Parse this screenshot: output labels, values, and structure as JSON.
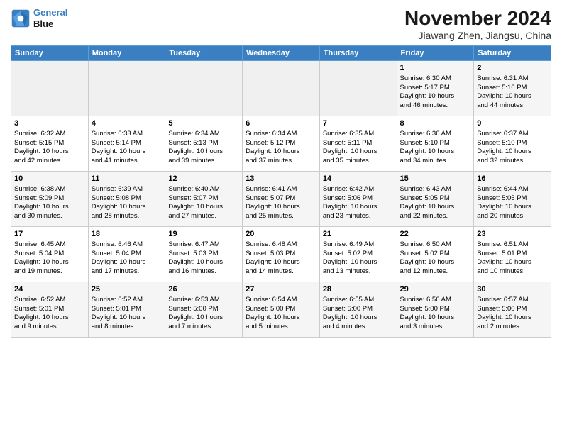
{
  "logo": {
    "line1": "General",
    "line2": "Blue"
  },
  "header": {
    "month": "November 2024",
    "location": "Jiawang Zhen, Jiangsu, China"
  },
  "weekdays": [
    "Sunday",
    "Monday",
    "Tuesday",
    "Wednesday",
    "Thursday",
    "Friday",
    "Saturday"
  ],
  "weeks": [
    [
      {
        "day": "",
        "info": ""
      },
      {
        "day": "",
        "info": ""
      },
      {
        "day": "",
        "info": ""
      },
      {
        "day": "",
        "info": ""
      },
      {
        "day": "",
        "info": ""
      },
      {
        "day": "1",
        "info": "Sunrise: 6:30 AM\nSunset: 5:17 PM\nDaylight: 10 hours\nand 46 minutes."
      },
      {
        "day": "2",
        "info": "Sunrise: 6:31 AM\nSunset: 5:16 PM\nDaylight: 10 hours\nand 44 minutes."
      }
    ],
    [
      {
        "day": "3",
        "info": "Sunrise: 6:32 AM\nSunset: 5:15 PM\nDaylight: 10 hours\nand 42 minutes."
      },
      {
        "day": "4",
        "info": "Sunrise: 6:33 AM\nSunset: 5:14 PM\nDaylight: 10 hours\nand 41 minutes."
      },
      {
        "day": "5",
        "info": "Sunrise: 6:34 AM\nSunset: 5:13 PM\nDaylight: 10 hours\nand 39 minutes."
      },
      {
        "day": "6",
        "info": "Sunrise: 6:34 AM\nSunset: 5:12 PM\nDaylight: 10 hours\nand 37 minutes."
      },
      {
        "day": "7",
        "info": "Sunrise: 6:35 AM\nSunset: 5:11 PM\nDaylight: 10 hours\nand 35 minutes."
      },
      {
        "day": "8",
        "info": "Sunrise: 6:36 AM\nSunset: 5:10 PM\nDaylight: 10 hours\nand 34 minutes."
      },
      {
        "day": "9",
        "info": "Sunrise: 6:37 AM\nSunset: 5:10 PM\nDaylight: 10 hours\nand 32 minutes."
      }
    ],
    [
      {
        "day": "10",
        "info": "Sunrise: 6:38 AM\nSunset: 5:09 PM\nDaylight: 10 hours\nand 30 minutes."
      },
      {
        "day": "11",
        "info": "Sunrise: 6:39 AM\nSunset: 5:08 PM\nDaylight: 10 hours\nand 28 minutes."
      },
      {
        "day": "12",
        "info": "Sunrise: 6:40 AM\nSunset: 5:07 PM\nDaylight: 10 hours\nand 27 minutes."
      },
      {
        "day": "13",
        "info": "Sunrise: 6:41 AM\nSunset: 5:07 PM\nDaylight: 10 hours\nand 25 minutes."
      },
      {
        "day": "14",
        "info": "Sunrise: 6:42 AM\nSunset: 5:06 PM\nDaylight: 10 hours\nand 23 minutes."
      },
      {
        "day": "15",
        "info": "Sunrise: 6:43 AM\nSunset: 5:05 PM\nDaylight: 10 hours\nand 22 minutes."
      },
      {
        "day": "16",
        "info": "Sunrise: 6:44 AM\nSunset: 5:05 PM\nDaylight: 10 hours\nand 20 minutes."
      }
    ],
    [
      {
        "day": "17",
        "info": "Sunrise: 6:45 AM\nSunset: 5:04 PM\nDaylight: 10 hours\nand 19 minutes."
      },
      {
        "day": "18",
        "info": "Sunrise: 6:46 AM\nSunset: 5:04 PM\nDaylight: 10 hours\nand 17 minutes."
      },
      {
        "day": "19",
        "info": "Sunrise: 6:47 AM\nSunset: 5:03 PM\nDaylight: 10 hours\nand 16 minutes."
      },
      {
        "day": "20",
        "info": "Sunrise: 6:48 AM\nSunset: 5:03 PM\nDaylight: 10 hours\nand 14 minutes."
      },
      {
        "day": "21",
        "info": "Sunrise: 6:49 AM\nSunset: 5:02 PM\nDaylight: 10 hours\nand 13 minutes."
      },
      {
        "day": "22",
        "info": "Sunrise: 6:50 AM\nSunset: 5:02 PM\nDaylight: 10 hours\nand 12 minutes."
      },
      {
        "day": "23",
        "info": "Sunrise: 6:51 AM\nSunset: 5:01 PM\nDaylight: 10 hours\nand 10 minutes."
      }
    ],
    [
      {
        "day": "24",
        "info": "Sunrise: 6:52 AM\nSunset: 5:01 PM\nDaylight: 10 hours\nand 9 minutes."
      },
      {
        "day": "25",
        "info": "Sunrise: 6:52 AM\nSunset: 5:01 PM\nDaylight: 10 hours\nand 8 minutes."
      },
      {
        "day": "26",
        "info": "Sunrise: 6:53 AM\nSunset: 5:00 PM\nDaylight: 10 hours\nand 7 minutes."
      },
      {
        "day": "27",
        "info": "Sunrise: 6:54 AM\nSunset: 5:00 PM\nDaylight: 10 hours\nand 5 minutes."
      },
      {
        "day": "28",
        "info": "Sunrise: 6:55 AM\nSunset: 5:00 PM\nDaylight: 10 hours\nand 4 minutes."
      },
      {
        "day": "29",
        "info": "Sunrise: 6:56 AM\nSunset: 5:00 PM\nDaylight: 10 hours\nand 3 minutes."
      },
      {
        "day": "30",
        "info": "Sunrise: 6:57 AM\nSunset: 5:00 PM\nDaylight: 10 hours\nand 2 minutes."
      }
    ]
  ]
}
